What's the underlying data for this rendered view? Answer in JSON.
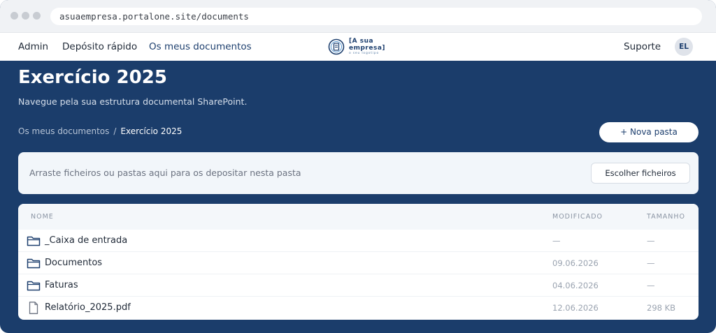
{
  "browser": {
    "url": "asuaempresa.portalone.site/documents"
  },
  "nav": {
    "admin": "Admin",
    "quick_deposit": "Depósito rápido",
    "my_documents": "Os meus documentos",
    "support": "Suporte",
    "avatar_initials": "EL",
    "logo_line1": "[A sua",
    "logo_line2": "empresa]",
    "logo_tagline": "o seu logotipo"
  },
  "page": {
    "title": "Exercício 2025",
    "subtitle": "Navegue pela sua estrutura documental SharePoint."
  },
  "breadcrumb": {
    "root": "Os meus documentos",
    "separator": "/",
    "current": "Exercício 2025"
  },
  "actions": {
    "new_folder": "+ Nova pasta",
    "choose_files": "Escolher ficheiros"
  },
  "dropzone": {
    "text": "Arraste ficheiros ou pastas aqui para os depositar nesta pasta"
  },
  "table": {
    "headers": {
      "name": "NOME",
      "modified": "MODIFICADO",
      "size": "TAMANHO"
    },
    "rows": [
      {
        "icon": "folder-icon",
        "name": "_Caixa de entrada",
        "modified": "—",
        "size": "—"
      },
      {
        "icon": "folder-icon",
        "name": "Documentos",
        "modified": "09.06.2026",
        "size": "—"
      },
      {
        "icon": "folder-icon",
        "name": "Faturas",
        "modified": "04.06.2026",
        "size": "—"
      },
      {
        "icon": "file-icon",
        "name": "Relatório_2025.pdf",
        "modified": "12.06.2026",
        "size": "298 KB"
      }
    ]
  },
  "colors": {
    "brand_navy": "#1b3d6b",
    "accent_link": "#1d3f6e"
  }
}
